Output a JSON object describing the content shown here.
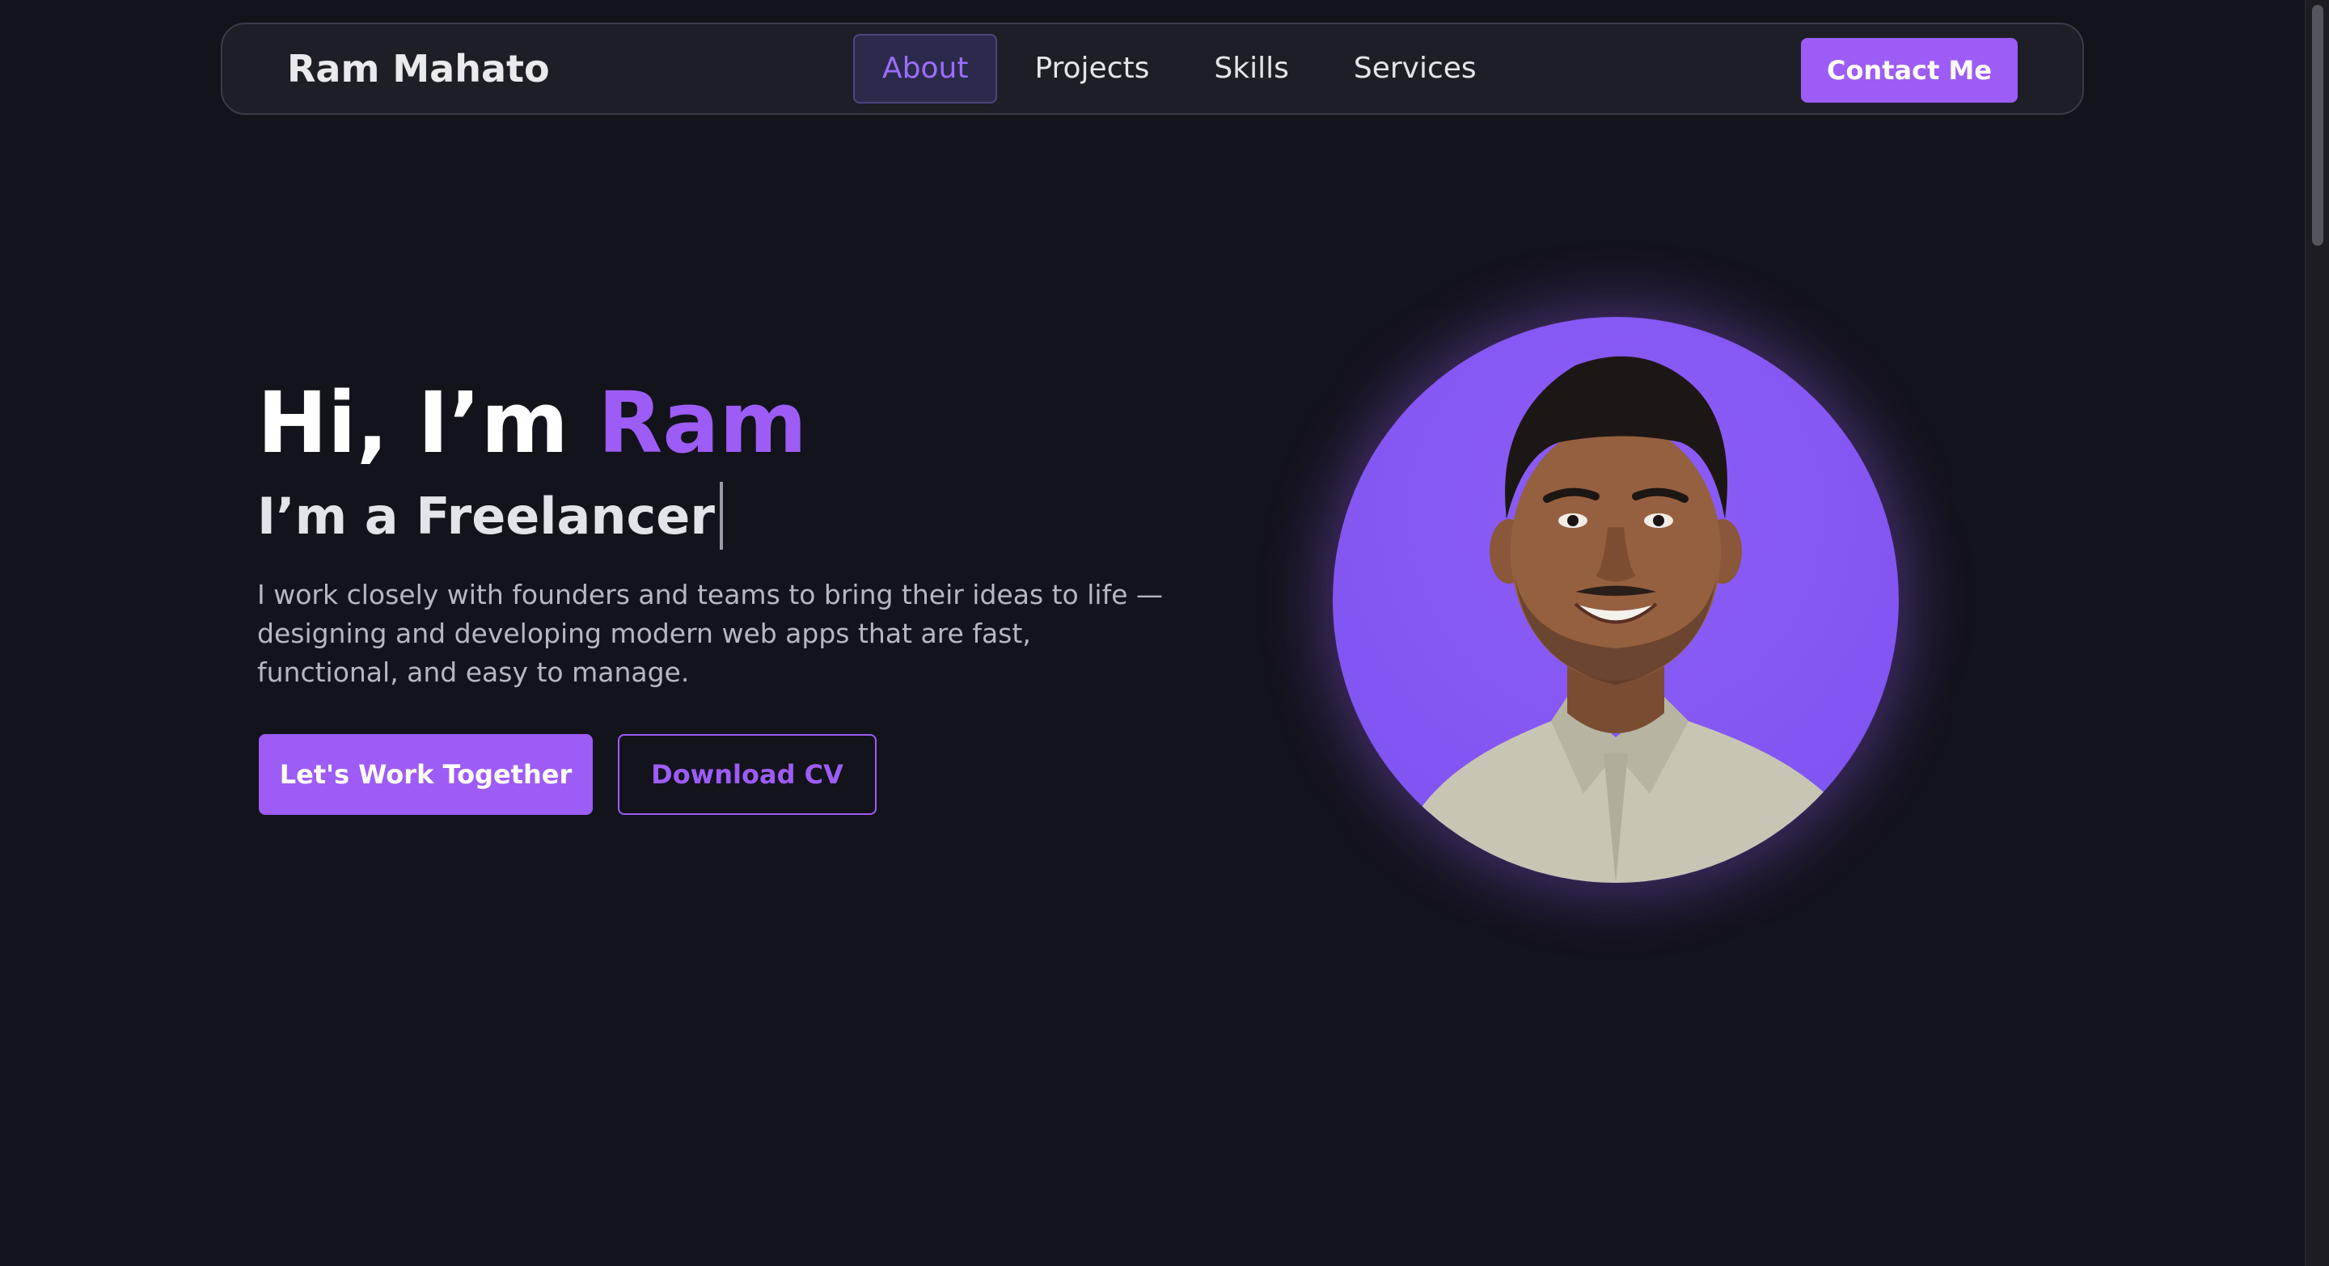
{
  "nav": {
    "brand": "Ram Mahato",
    "links": [
      {
        "label": "About",
        "active": true
      },
      {
        "label": "Projects",
        "active": false
      },
      {
        "label": "Skills",
        "active": false
      },
      {
        "label": "Services",
        "active": false
      }
    ],
    "contact_label": "Contact Me"
  },
  "hero": {
    "greeting": "Hi, I’m",
    "name": "Ram",
    "role": "I’m a Freelancer",
    "description": "I work closely with founders and teams to bring their ideas to life — designing and developing modern web apps that are fast, functional, and easy to manage.",
    "primary_cta": "Let's Work Together",
    "secondary_cta": "Download CV"
  },
  "colors": {
    "background": "#13131c",
    "accent": "#9d5cf5",
    "navbar": "#1e1e27"
  },
  "icons": {
    "portrait": "profile-photo"
  }
}
